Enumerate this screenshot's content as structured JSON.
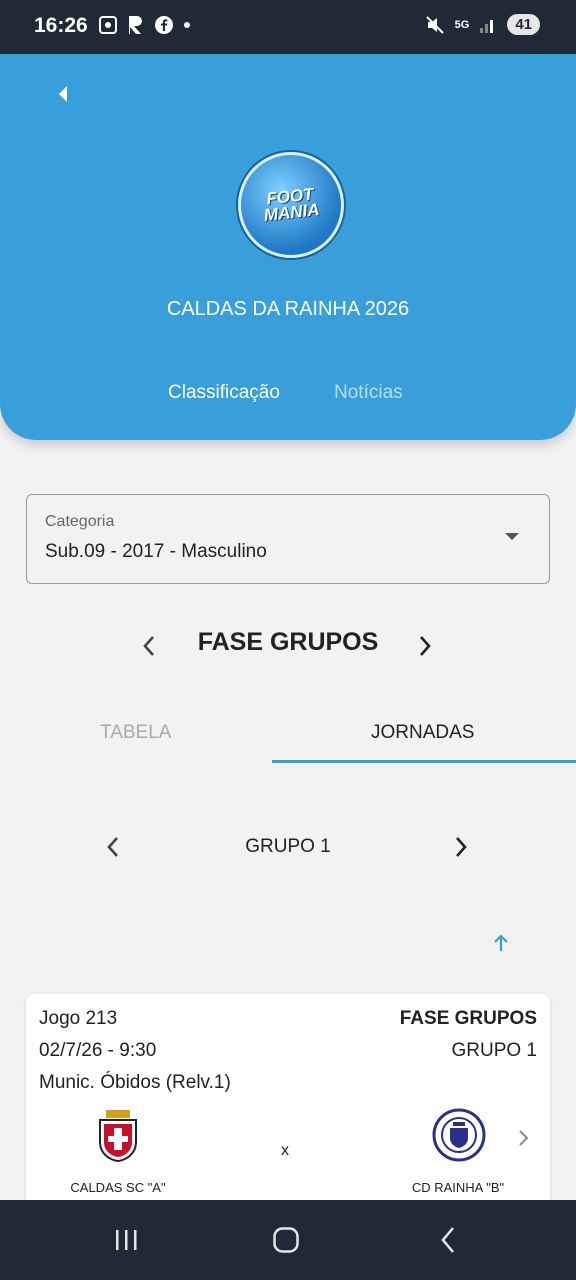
{
  "status_bar": {
    "time": "16:26",
    "left_icons": [
      "screenshot-icon",
      "r-app-icon",
      "facebook-icon",
      "dot-icon"
    ],
    "right_icons": [
      "mute-icon",
      "5g-icon",
      "signal-icon"
    ],
    "network": "5G",
    "battery": "41"
  },
  "header": {
    "logo_text_line1": "FOOT",
    "logo_text_line2": "MANIA",
    "title": "CALDAS DA RAINHA 2026",
    "tabs": [
      {
        "label": "Classificação",
        "active": true
      },
      {
        "label": "Notícias",
        "active": false
      }
    ],
    "color": "#389fdb"
  },
  "category_select": {
    "label": "Categoria",
    "value": "Sub.09 - 2017 - Masculino"
  },
  "phase": {
    "title": "FASE GRUPOS"
  },
  "subtabs": [
    {
      "label": "TABELA",
      "active": false
    },
    {
      "label": "JORNADAS",
      "active": true
    }
  ],
  "group": {
    "title": "GRUPO 1"
  },
  "match": {
    "game": "Jogo 213",
    "phase": "FASE GRUPOS",
    "datetime": "02/7/26 - 9:30",
    "group": "GRUPO 1",
    "venue": "Munic. Óbidos (Relv.1)",
    "home_team": "CALDAS SC \"A\"",
    "away_team": "CD RAINHA \"B\"",
    "separator": "x"
  },
  "accent_color": "#389fdb"
}
